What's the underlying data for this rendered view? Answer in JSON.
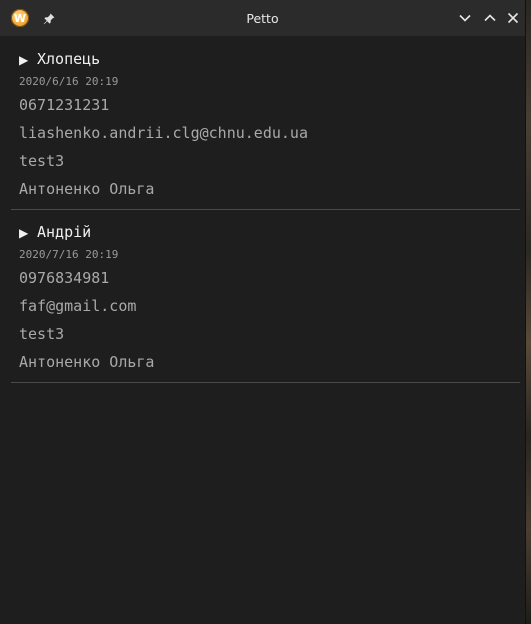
{
  "window": {
    "title": "Petto",
    "app_icon_letter": "W",
    "icons": {
      "app": "app-logo-icon",
      "pin": "pin-icon",
      "minimize": "chevron-down-icon",
      "maximize": "chevron-up-icon",
      "close": "close-icon"
    }
  },
  "entries": [
    {
      "name": "Хлопець",
      "date": "2020/6/16 20:19",
      "phone": "0671231231",
      "email": "liashenko.andrii.clg@chnu.edu.ua",
      "note": "test3",
      "owner": "Антоненко Ольга"
    },
    {
      "name": "Андрій",
      "date": "2020/7/16 20:19",
      "phone": "0976834981",
      "email": "faf@gmail.com",
      "note": "test3",
      "owner": "Антоненко Ольга"
    }
  ],
  "colors": {
    "background": "#1e1e1e",
    "titlebar": "#2b2b2b",
    "header_text": "#f0f0f0",
    "field_text": "#a9a9a9",
    "divider": "#4a4a4a"
  }
}
